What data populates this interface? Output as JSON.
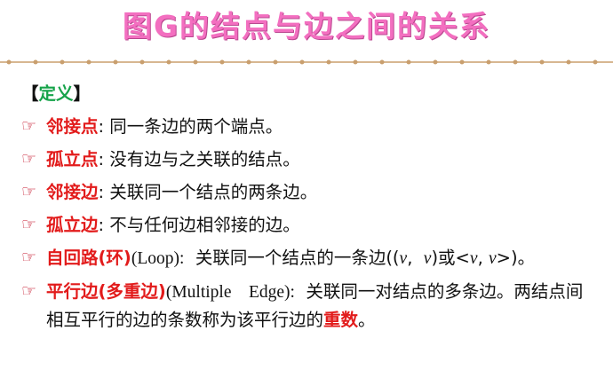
{
  "title": "图G的结点与边之间的关系",
  "section": {
    "open": "【",
    "label": "定义",
    "close": "】"
  },
  "items": [
    {
      "term": "邻接点",
      "desc": ": 同一条边的两个端点。"
    },
    {
      "term": "孤立点",
      "desc": ": 没有边与之关联的结点。"
    },
    {
      "term": "邻接边",
      "desc": ": 关联同一个结点的两条边。"
    },
    {
      "term": "孤立边",
      "desc": ": 不与任何边相邻接的边。"
    },
    {
      "term": "自回路(环)",
      "eng": "(Loop):",
      "desc": "关联同一个结点的一条边((",
      "v1": "v",
      "sep": ",",
      "v2": "v",
      "mid": ")或<",
      "v3": "v",
      "sep2": ",",
      "v4": "v",
      "end": ">)。"
    },
    {
      "term": "平行边(多重边)",
      "eng": "(Multiple    Edge):",
      "desc": "关联同一对结点的多条边。两结点间相互平行的边的条数称为该平行边的",
      "term2": "重数",
      "end": "。"
    }
  ],
  "icons": {
    "bullet": "pointing-hand-icon"
  },
  "colors": {
    "title": "#f36fc0",
    "term": "#e21b1b",
    "section": "#16a34a",
    "bullet": "#c5162c"
  }
}
